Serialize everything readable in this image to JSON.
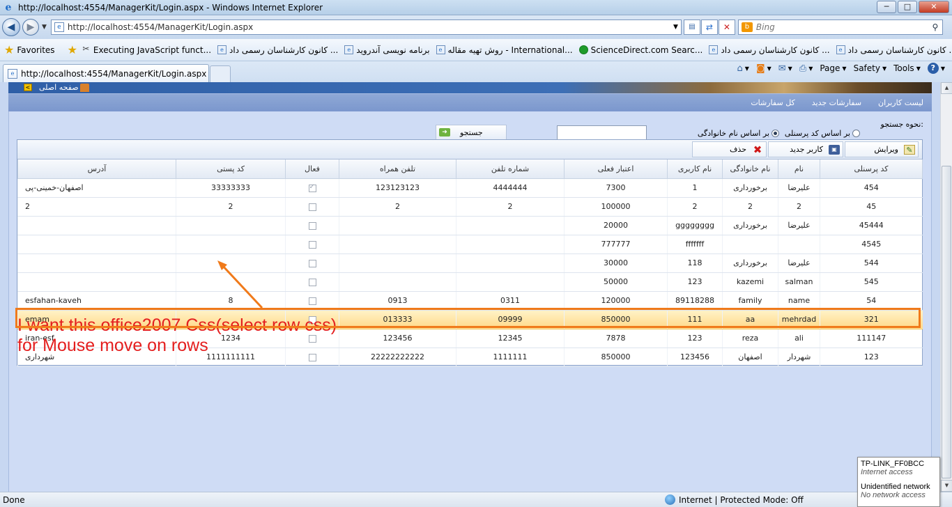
{
  "window": {
    "title": "http://localhost:4554/ManagerKit/Login.aspx - Windows Internet Explorer",
    "buttons": {
      "minimize": "─",
      "maximize": "□",
      "close": "✕"
    }
  },
  "address_bar": {
    "url": "http://localhost:4554/ManagerKit/Login.aspx",
    "search_placeholder": "Bing"
  },
  "favorites_bar": {
    "label": "Favorites",
    "items": [
      {
        "label": "Executing JavaScript funct...",
        "icon": "tool-icon"
      },
      {
        "label": "کانون کارشناسان رسمی داد ...",
        "icon": "ie-page-icon"
      },
      {
        "label": "برنامه نویسی آندروید",
        "icon": "ie-page-icon"
      },
      {
        "label": "روش تهیه مقاله - International...",
        "icon": "ie-page-icon"
      },
      {
        "label": "ScienceDirect.com  Searc...",
        "icon": "green-circle-icon"
      },
      {
        "label": "کانون کارشناسان رسمی داد ...",
        "icon": "ie-page-icon"
      },
      {
        "label": "کانون کارشناسان رسمی داد ...",
        "icon": "ie-page-icon"
      }
    ]
  },
  "tabs": [
    {
      "label": "http://localhost:4554/ManagerKit/Login.aspx",
      "active": true
    }
  ],
  "command_bar": {
    "page": "Page",
    "safety": "Safety",
    "tools": "Tools"
  },
  "site": {
    "home_link": "صفحه اصلی",
    "menu": [
      "لیست کاربران",
      "سفارشات جدید",
      "کل سفارشات"
    ],
    "search": {
      "label": "نحوه جستجو:",
      "option_personnel": "بر اساس کد پرسنلی",
      "option_family": "بر اساس نام خانوادگی",
      "selected": "option_family",
      "query": "",
      "button": "جستجو"
    },
    "toolbar": {
      "edit": "ویرایش",
      "new_user": "کاربر جدید",
      "delete": "حذف"
    },
    "grid": {
      "columns": [
        "کد پرسنلی",
        "نام",
        "نام خانوادگی",
        "نام کاربری",
        "اعتبار فعلی",
        "شماره تلفن",
        "تلفن همراه",
        "فعال",
        "کد پستی",
        "آدرس"
      ],
      "rows": [
        {
          "code": "454",
          "name": "علیرضا",
          "family": "برخورداری",
          "username": "1",
          "credit": "7300",
          "phone": "4444444",
          "mobile": "123123123",
          "active": true,
          "postal": "33333333",
          "address": "اصفهان-خمینی-پی"
        },
        {
          "code": "45",
          "name": "2",
          "family": "2",
          "username": "2",
          "credit": "100000",
          "phone": "2",
          "mobile": "2",
          "active": false,
          "postal": "2",
          "address": "2"
        },
        {
          "code": "45444",
          "name": "علیرضا",
          "family": "برخورداری",
          "username": "gggggggg",
          "credit": "20000",
          "phone": "",
          "mobile": "",
          "active": false,
          "postal": "",
          "address": ""
        },
        {
          "code": "4545",
          "name": "",
          "family": "",
          "username": "fffffff",
          "credit": "777777",
          "phone": "",
          "mobile": "",
          "active": false,
          "postal": "",
          "address": ""
        },
        {
          "code": "544",
          "name": "علیرضا",
          "family": "برخورداری",
          "username": "118",
          "credit": "30000",
          "phone": "",
          "mobile": "",
          "active": false,
          "postal": "",
          "address": ""
        },
        {
          "code": "545",
          "name": "salman",
          "family": "kazemi",
          "username": "123",
          "credit": "50000",
          "phone": "",
          "mobile": "",
          "active": false,
          "postal": "",
          "address": ""
        },
        {
          "code": "54",
          "name": "name",
          "family": "family",
          "username": "89118288",
          "credit": "120000",
          "phone": "0311",
          "mobile": "0913",
          "active": false,
          "postal": "8",
          "address": "esfahan-kaveh"
        },
        {
          "code": "321",
          "name": "mehrdad",
          "family": "aa",
          "username": "111",
          "credit": "850000",
          "phone": "09999",
          "mobile": "013333",
          "active": false,
          "postal": "",
          "address": "emam",
          "selected": true
        },
        {
          "code": "111147",
          "name": "ali",
          "family": "reza",
          "username": "123",
          "credit": "7878",
          "phone": "12345",
          "mobile": "123456",
          "active": false,
          "postal": "1234",
          "address": "iran-esf"
        },
        {
          "code": "123",
          "name": "شهردار",
          "family": "اصفهان",
          "username": "123456",
          "credit": "850000",
          "phone": "1111111",
          "mobile": "22222222222",
          "active": false,
          "postal": "1111111111",
          "address": "شهرداری"
        }
      ]
    }
  },
  "annotation": {
    "line1": "I want this office2007 Css(select row css)",
    "line2": "for Mouse move on rows",
    "color": "#e41e1e",
    "highlight_color": "#f07a1a"
  },
  "status_bar": {
    "left": "Done",
    "zone": "Internet | Protected Mode: Off"
  },
  "network_popup": {
    "ssid": "TP-LINK_FF0BCC",
    "ssid_status": "Internet access",
    "network": "Unidentified network",
    "network_status": "No network access"
  }
}
